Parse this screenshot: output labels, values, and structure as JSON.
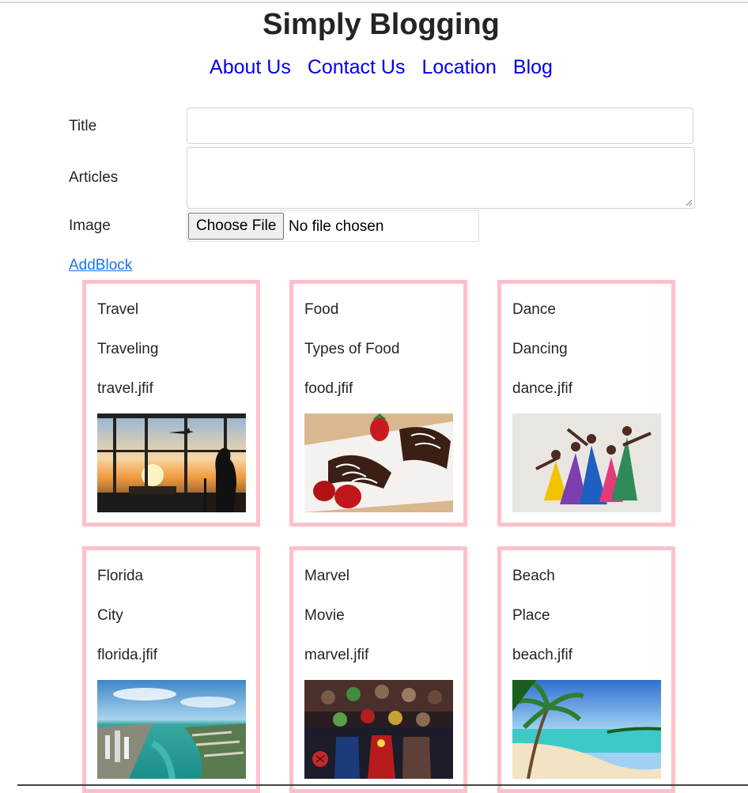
{
  "site": {
    "title": "Simply Blogging"
  },
  "nav": [
    "About Us",
    "Contact Us",
    "Location",
    "Blog"
  ],
  "form": {
    "title_label": "Title",
    "title_value": "",
    "articles_label": "Articles",
    "articles_value": "",
    "image_label": "Image",
    "file_button_label": "Choose File",
    "file_status": "No file chosen"
  },
  "add_block_label": "AddBlock",
  "posts": [
    {
      "title": "Travel",
      "article": "Traveling",
      "image": "travel.jfif",
      "photo_icon": "airport-sunset-photo"
    },
    {
      "title": "Food",
      "article": "Types of Food",
      "image": "food.jfif",
      "photo_icon": "chocolate-dessert-photo"
    },
    {
      "title": "Dance",
      "article": "Dancing",
      "image": "dance.jfif",
      "photo_icon": "dancers-photo"
    },
    {
      "title": "Florida",
      "article": "City",
      "image": "florida.jfif",
      "photo_icon": "miami-aerial-photo"
    },
    {
      "title": "Marvel",
      "article": "Movie",
      "image": "marvel.jfif",
      "photo_icon": "superhero-group-photo"
    },
    {
      "title": "Beach",
      "article": "Place",
      "image": "beach.jfif",
      "photo_icon": "tropical-beach-photo"
    }
  ],
  "colors": {
    "card_border": "#ffc0cb",
    "nav_link": "#0000ee",
    "add_link": "#1a73e8",
    "text": "#212529"
  }
}
